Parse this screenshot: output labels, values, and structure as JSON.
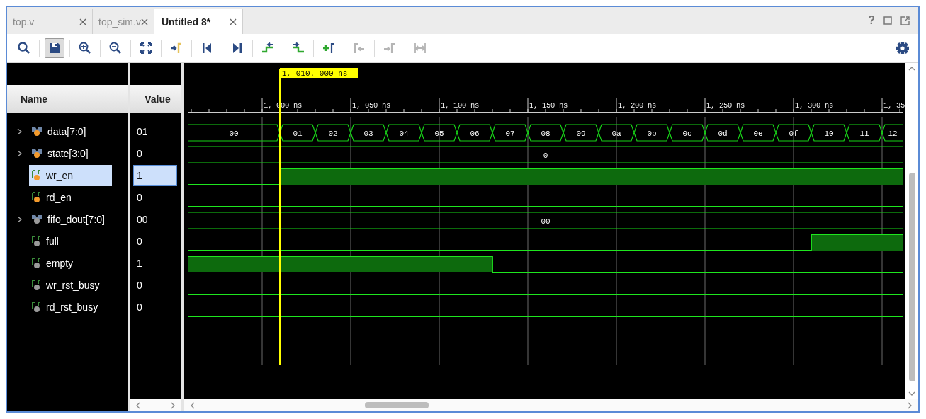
{
  "tabs": [
    {
      "label": "top.v",
      "selected": false
    },
    {
      "label": "top_sim.v",
      "selected": false
    },
    {
      "label": "Untitled 8*",
      "selected": true
    }
  ],
  "window_controls": {
    "help": "?"
  },
  "toolbar": [
    {
      "kind": "search",
      "disabled": false,
      "pressed": false
    },
    {
      "kind": "save",
      "disabled": false,
      "pressed": true
    },
    {
      "kind": "zoom-in",
      "disabled": false,
      "pressed": false
    },
    {
      "kind": "zoom-out",
      "disabled": false,
      "pressed": false
    },
    {
      "kind": "fit",
      "disabled": false,
      "pressed": false
    },
    {
      "kind": "go-cursor",
      "disabled": false,
      "pressed": false
    },
    {
      "kind": "first",
      "disabled": false,
      "pressed": false
    },
    {
      "kind": "last",
      "disabled": false,
      "pressed": false
    },
    {
      "kind": "prev-edge",
      "disabled": false,
      "pressed": false
    },
    {
      "kind": "next-edge",
      "disabled": false,
      "pressed": false
    },
    {
      "kind": "add-marker",
      "disabled": false,
      "pressed": false
    },
    {
      "kind": "prev-marker",
      "disabled": true,
      "pressed": false
    },
    {
      "kind": "next-marker",
      "disabled": true,
      "pressed": false
    },
    {
      "kind": "swap",
      "disabled": true,
      "pressed": false
    }
  ],
  "columns": {
    "name": "Name",
    "value": "Value"
  },
  "signals": [
    {
      "name": "data[7:0]",
      "kind": "bus",
      "value": "01",
      "color": "#f39a2c",
      "selected": false,
      "labels": [
        "00",
        "01",
        "02",
        "03",
        "04",
        "05",
        "06",
        "07",
        "08",
        "09",
        "0a",
        "0b",
        "0c",
        "0d",
        "0e",
        "0f",
        "10",
        "11",
        "12"
      ]
    },
    {
      "name": "state[3:0]",
      "kind": "bus",
      "value": "0",
      "color": "#f39a2c",
      "selected": false,
      "labels": [
        "0"
      ]
    },
    {
      "name": "wr_en",
      "kind": "bit",
      "value": "1",
      "color": "#f39a2c",
      "selected": true
    },
    {
      "name": "rd_en",
      "kind": "bit",
      "value": "0",
      "color": "#f39a2c",
      "selected": false
    },
    {
      "name": "fifo_dout[7:0]",
      "kind": "bus",
      "value": "00",
      "color": "#9a9a9a",
      "selected": false,
      "labels": [
        "00"
      ]
    },
    {
      "name": "full",
      "kind": "bit",
      "value": "0",
      "color": "#9a9a9a",
      "selected": false
    },
    {
      "name": "empty",
      "kind": "bit",
      "value": "1",
      "color": "#9a9a9a",
      "selected": false
    },
    {
      "name": "wr_rst_busy",
      "kind": "bit",
      "value": "0",
      "color": "#9a9a9a",
      "selected": false
    },
    {
      "name": "rd_rst_busy",
      "kind": "bit",
      "value": "0",
      "color": "#9a9a9a",
      "selected": false
    }
  ],
  "waveform": {
    "ruler_labels": [
      "1, 000 ns",
      "1, 050 ns",
      "1, 100 ns",
      "1, 150 ns",
      "1, 200 ns",
      "1, 250 ns",
      "1, 300 ns",
      "1, 35"
    ],
    "cursor_label": "1, 010. 000 ns"
  }
}
